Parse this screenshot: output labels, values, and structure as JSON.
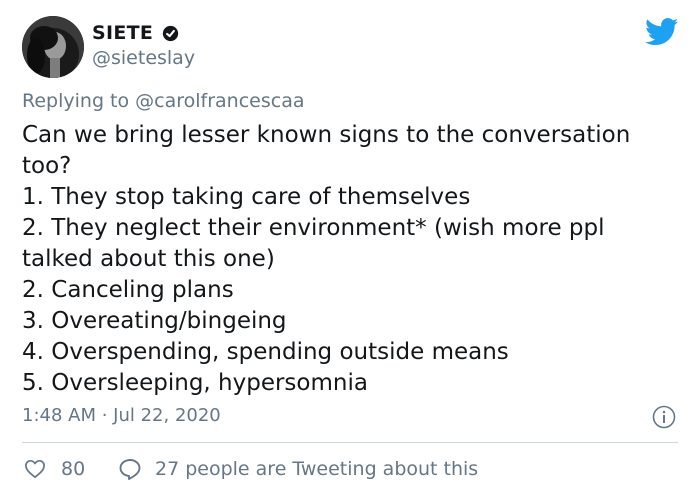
{
  "tweet": {
    "author_name": "SIETE",
    "handle": "@sieteslay",
    "replying_prefix": "Replying to ",
    "replying_to": "@carolfrancescaa",
    "lines": [
      "Can we bring lesser known signs to the conversation",
      "too?",
      "1. They stop taking care of themselves",
      "2. They neglect their environment* (wish more ppl",
      "talked about this one)",
      "2. Canceling plans",
      "3. Overeating/bingeing",
      "4. Overspending, spending outside means",
      "5. Oversleeping, hypersomnia"
    ],
    "timestamp": "1:48 AM · Jul 22, 2020",
    "like_count": "80",
    "tweeting_text": "27 people are Tweeting about this"
  },
  "icons": {
    "avatar": "profile-photo",
    "verified": "verified-badge-icon",
    "logo": "twitter-bird-icon",
    "info": "info-icon",
    "like": "heart-icon",
    "reply": "speech-bubble-icon"
  },
  "colors": {
    "text": "#14171a",
    "secondary": "#657786",
    "twitter_blue": "#1da1f2",
    "divider": "#ccd6dd"
  }
}
